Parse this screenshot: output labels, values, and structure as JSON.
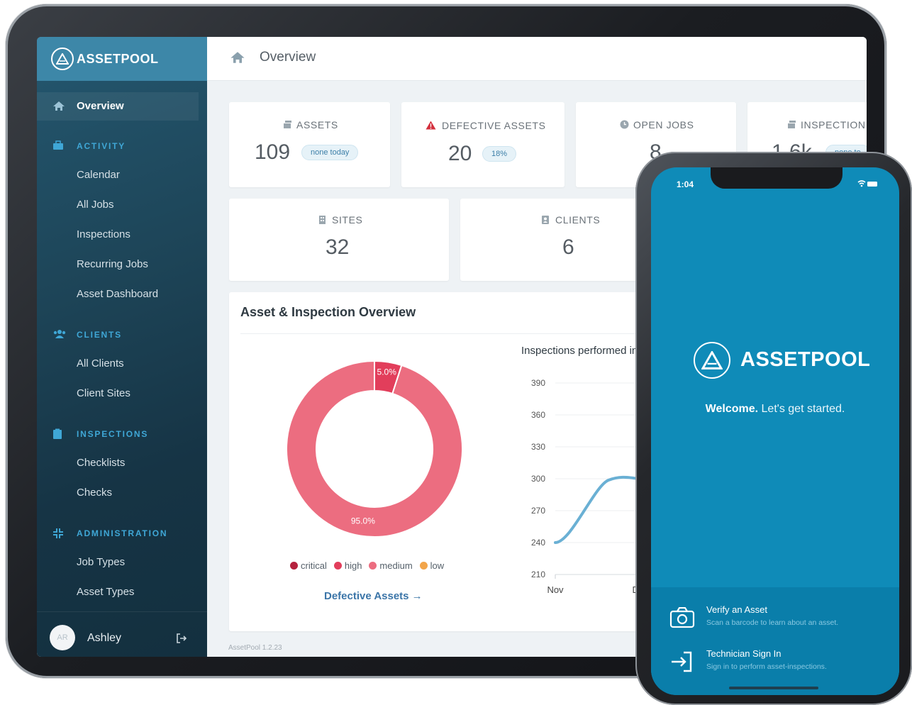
{
  "app": {
    "brand": "ASSETPOOL",
    "page_title": "Overview",
    "footer": "AssetPool  1.2.23"
  },
  "sidebar": {
    "active": "Overview",
    "sections": [
      {
        "title": "ACTIVITY",
        "icon": "briefcase-icon",
        "items": [
          "Calendar",
          "All Jobs",
          "Inspections",
          "Recurring Jobs",
          "Asset Dashboard"
        ]
      },
      {
        "title": "CLIENTS",
        "icon": "users-icon",
        "items": [
          "All Clients",
          "Client Sites"
        ]
      },
      {
        "title": "INSPECTIONS",
        "icon": "clipboard-icon",
        "items": [
          "Checklists",
          "Checks"
        ]
      },
      {
        "title": "ADMINISTRATION",
        "icon": "compress-icon",
        "items": [
          "Job Types",
          "Asset Types"
        ]
      }
    ],
    "user": {
      "initials": "AR",
      "name": "Ashley"
    }
  },
  "stats": [
    {
      "label": "ASSETS",
      "value": "109",
      "badge": "none today"
    },
    {
      "label": "DEFECTIVE ASSETS",
      "value": "20",
      "badge": "18%"
    },
    {
      "label": "OPEN JOBS",
      "value": "8"
    },
    {
      "label": "INSPECTION",
      "value": "1.6k",
      "badge": "none to"
    },
    {
      "label": "SITES",
      "value": "32"
    },
    {
      "label": "CLIENTS",
      "value": "6"
    }
  ],
  "overview": {
    "title": "Asset & Inspection Overview",
    "link": "Defective Assets →",
    "line_title": "Inspections performed in"
  },
  "chart_data": [
    {
      "type": "pie",
      "title": "",
      "categories": [
        "critical",
        "high",
        "medium",
        "low"
      ],
      "values": [
        0,
        5.0,
        95.0,
        0
      ],
      "value_labels": [
        "",
        "5.0%",
        "95.0%",
        ""
      ],
      "colors": [
        "#b5223e",
        "#e23e5b",
        "#ec6d80",
        "#f2a54a"
      ],
      "legend": "bottom"
    },
    {
      "type": "line",
      "title": "Inspections performed in",
      "x": [
        "Nov",
        "Dec"
      ],
      "series": [
        {
          "values": [
            240,
            300
          ]
        }
      ],
      "yticks": [
        390,
        360,
        330,
        300,
        270,
        240,
        210
      ],
      "ylim": [
        210,
        390
      ],
      "grid": true
    }
  ],
  "phone": {
    "time": "1:04",
    "brand": "ASSETPOOL",
    "welcome_bold": "Welcome.",
    "welcome_rest": " Let's get started.",
    "actions": [
      {
        "title": "Verify an Asset",
        "subtitle": "Scan a barcode to learn about an asset."
      },
      {
        "title": "Technician Sign In",
        "subtitle": "Sign in to perform asset-inspections."
      }
    ]
  }
}
